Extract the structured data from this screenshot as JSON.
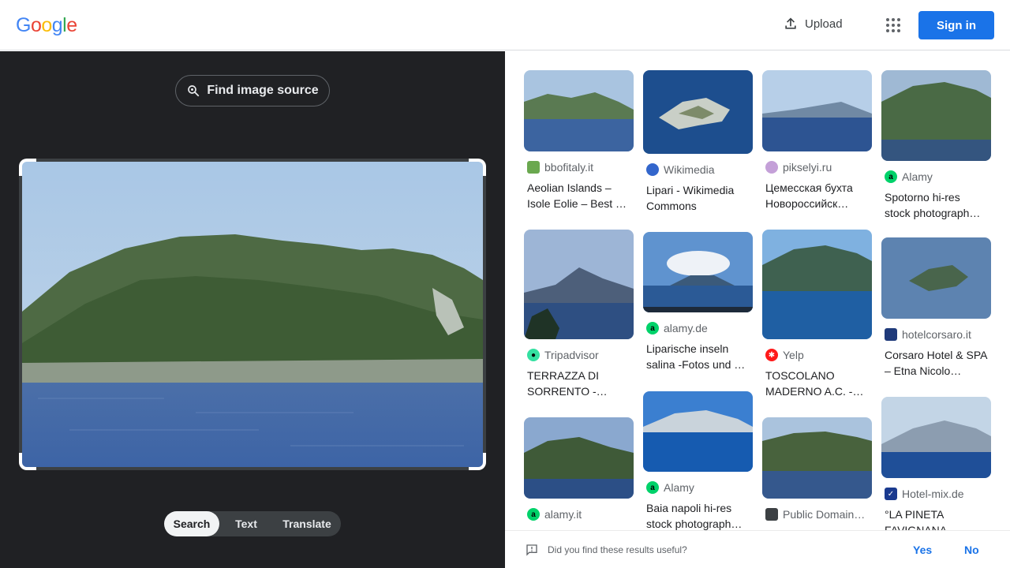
{
  "header": {
    "logo_letters": [
      "G",
      "o",
      "o",
      "g",
      "l",
      "e"
    ],
    "logo_colors": [
      "#4285F4",
      "#EA4335",
      "#FBBC05",
      "#4285F4",
      "#34A853",
      "#EA4335"
    ],
    "upload_label": "Upload",
    "apps_icon": "apps-grid-icon",
    "sign_in_label": "Sign in",
    "accent_color": "#1a73e8"
  },
  "left_panel": {
    "find_source_label": "Find image source",
    "modes": [
      "Search",
      "Text",
      "Translate"
    ],
    "active_mode": "Search"
  },
  "results": [
    {
      "source": "bbofitaly.it",
      "title": "Aeolian Islands – Isole Eolie – Best …",
      "fav_color": "#6aa84f",
      "fav_char": ""
    },
    {
      "source": "Wikimedia",
      "title": "Lipari - Wikimedia Commons",
      "fav_color": "#3366cc",
      "fav_char": ""
    },
    {
      "source": "pikselyi.ru",
      "title": "Цемесская бухта Новороссийск…",
      "fav_color": "#c4a0d8",
      "fav_char": ""
    },
    {
      "source": "Alamy",
      "title": "Spotorno hi-res stock photograph…",
      "fav_color": "#00d26a",
      "fav_char": "a"
    },
    {
      "source": "Tripadvisor",
      "title": "TERRAZZA DI SORRENTO -…",
      "fav_color": "#34e0a1",
      "fav_char": "●"
    },
    {
      "source": "alamy.de",
      "title": "Liparische inseln salina -Fotos und …",
      "fav_color": "#00d26a",
      "fav_char": "a"
    },
    {
      "source": "Yelp",
      "title": "TOSCOLANO MADERNO A.C. -…",
      "fav_color": "#ff1a1a",
      "fav_char": "✱"
    },
    {
      "source": "hotelcorsaro.it",
      "title": "Corsaro Hotel & SPA – Etna Nicolo…",
      "fav_color": "#1f3a7a",
      "fav_char": ""
    },
    {
      "source": "alamy.it",
      "title": "",
      "fav_color": "#00d26a",
      "fav_char": "a"
    },
    {
      "source": "Alamy",
      "title": "Baia napoli hi-res stock photograph…",
      "fav_color": "#00d26a",
      "fav_char": "a"
    },
    {
      "source": "Public Domain…",
      "title": "",
      "fav_color": "#3c4043",
      "fav_char": ""
    },
    {
      "source": "Hotel-mix.de",
      "title": "°LA PINETA FAVIGNANA…",
      "fav_color": "#1a3a8f",
      "fav_char": "✓"
    }
  ],
  "feedback": {
    "question": "Did you find these results useful?",
    "yes_label": "Yes",
    "no_label": "No"
  }
}
